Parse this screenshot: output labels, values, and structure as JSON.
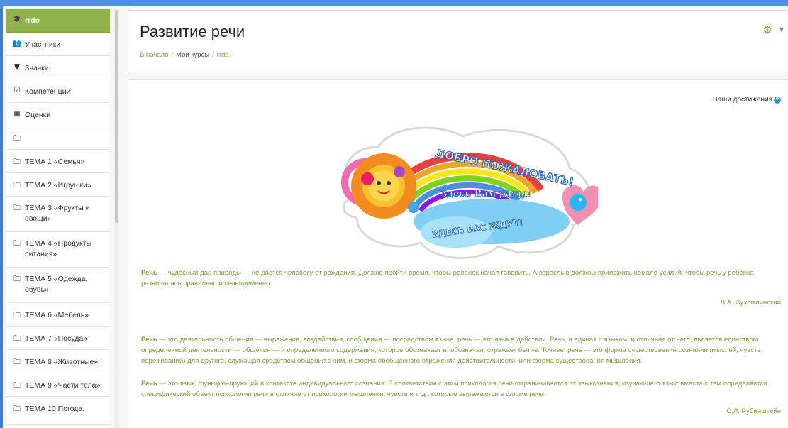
{
  "course_title": "Развитие речи",
  "breadcrumb": {
    "home": "В начало",
    "my_courses": "Мои курсы",
    "course": "rrdo"
  },
  "sidebar": {
    "items": [
      {
        "label": "rrdo",
        "icon": "graduation-cap-icon",
        "active": true
      },
      {
        "label": "Участники",
        "icon": "users-icon"
      },
      {
        "label": "Значки",
        "icon": "shield-icon"
      },
      {
        "label": "Компетенции",
        "icon": "checkbox-icon"
      },
      {
        "label": "Оценки",
        "icon": "table-icon"
      },
      {
        "label": "",
        "icon": "folder-icon"
      },
      {
        "label": "ТЕМА 1 «Семья»",
        "icon": "folder-icon"
      },
      {
        "label": "ТЕМА 2 «Игрушки»",
        "icon": "folder-icon"
      },
      {
        "label": "ТЕМА 3 «Фрукты и овощи»",
        "icon": "folder-icon"
      },
      {
        "label": "ТЕМА 4 «Продукты питания»",
        "icon": "folder-icon"
      },
      {
        "label": "ТЕМА 5 «Одежда, обувь»",
        "icon": "folder-icon"
      },
      {
        "label": "ТЕМА 6 «Мебель»",
        "icon": "folder-icon"
      },
      {
        "label": "ТЕМА 7 «Посуда»",
        "icon": "folder-icon"
      },
      {
        "label": "ТЕМА 8 «Животные»",
        "icon": "folder-icon"
      },
      {
        "label": "ТЕМА 9 «Части тела»",
        "icon": "folder-icon"
      },
      {
        "label": "ТЕМА 10 Погода.",
        "icon": "folder-icon"
      }
    ]
  },
  "achievements_label": "Ваши достижения",
  "banner": {
    "line1": "ДОБРО ПОЖАЛОВАТЬ!",
    "line2": "Здесь Вам рады!",
    "line3": "ЗДЕСЬ ВАС ЖДУТ!"
  },
  "quote1": {
    "term": "Речь",
    "text": " — чудесный дар природы — не дается человеку от рождения. Должно пройти время, чтобы ребенок начал говорить. А взрослые должны приложить немало усилий, чтобы речь у ребенка развивалась правильно и своевременно.",
    "author": "В.А. Сухомлинский"
  },
  "quote2": {
    "term": "Речь",
    "text": " — это деятельность общения — выражения, воздействия, сообщения — посредством языка, речь — это язык в действии. Речь, и единая с языком, и отличная от него, является единством определенной деятельности — общения — и определенного содержания, которое обозначает и, обозначая, отражает бытие. Точнее, речь — это форма существования сознания (мыслей, чувств, переживаний) для другого, служащая средством общения с ним, и форма обобщенного отражения действительности, или форма существования мышления."
  },
  "quote3": {
    "term": "Речь",
    "text": " — это язык, функционирующий в контексте индивидуального сознания. В соответствии с этим психология речи отграничивается от языкознания, изучающего язык; вместе с тем определяется специфический объект психологии речи в отличие от психологии мышления, чувств и т. д., которые выражаются в форме речи.",
    "author": "С.Л. Рубинштейн"
  },
  "colors": {
    "accent": "#8fb24a",
    "accent_text": "#7da03d",
    "desktop_blue": "#3a7fd6"
  }
}
